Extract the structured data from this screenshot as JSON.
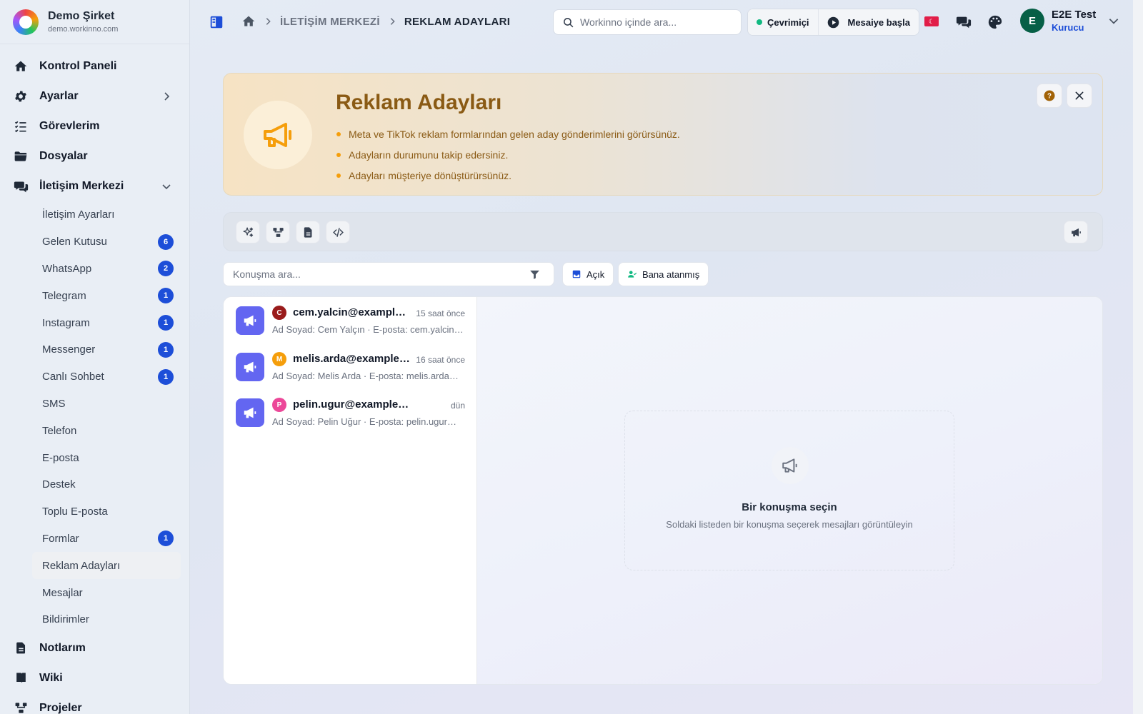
{
  "brand": {
    "name": "Demo Şirket",
    "domain": "demo.workinno.com"
  },
  "nav": {
    "dashboard": "Kontrol Paneli",
    "settings": "Ayarlar",
    "tasks": "Görevlerim",
    "files": "Dosyalar",
    "comm_center": "İletişim Merkezi",
    "sub_items": [
      {
        "label": "İletişim Ayarları",
        "badge": ""
      },
      {
        "label": "Gelen Kutusu",
        "badge": "6"
      },
      {
        "label": "WhatsApp",
        "badge": "2"
      },
      {
        "label": "Telegram",
        "badge": "1"
      },
      {
        "label": "Instagram",
        "badge": "1"
      },
      {
        "label": "Messenger",
        "badge": "1"
      },
      {
        "label": "Canlı Sohbet",
        "badge": "1"
      },
      {
        "label": "SMS",
        "badge": ""
      },
      {
        "label": "Telefon",
        "badge": ""
      },
      {
        "label": "E-posta",
        "badge": ""
      },
      {
        "label": "Destek",
        "badge": ""
      },
      {
        "label": "Toplu E-posta",
        "badge": ""
      },
      {
        "label": "Formlar",
        "badge": "1"
      },
      {
        "label": "Reklam Adayları",
        "badge": ""
      },
      {
        "label": "Mesajlar",
        "badge": ""
      },
      {
        "label": "Bildirimler",
        "badge": ""
      }
    ],
    "notes": "Notlarım",
    "wiki": "Wiki",
    "projects": "Projeler"
  },
  "topbar": {
    "breadcrumb_1": "İLETİŞİM MERKEZİ",
    "breadcrumb_2": "REKLAM ADAYLARI",
    "search_placeholder": "Workinno içinde ara...",
    "status": "Çevrimiçi",
    "shift_button": "Mesaiye başla",
    "user_initial": "E",
    "user_name": "E2E Test",
    "user_role": "Kurucu"
  },
  "hero": {
    "title": "Reklam Adayları",
    "bullets": [
      "Meta ve TikTok reklam formlarından gelen aday gönderimlerini görürsünüz.",
      "Adayların durumunu takip edersiniz.",
      "Adayları müşteriye dönüştürürsünüz."
    ]
  },
  "filters": {
    "search_placeholder": "Konuşma ara...",
    "open_chip": "Açık",
    "assigned_chip": "Bana atanmış"
  },
  "conversations": [
    {
      "initial": "C",
      "color": "#991b1b",
      "email": "cem.yalcin@example.com",
      "time": "15 saat önce",
      "preview": "Ad Soyad: Cem Yalçın · E-posta: cem.yalcin@example.com"
    },
    {
      "initial": "M",
      "color": "#f59e0b",
      "email": "melis.arda@example.com",
      "time": "16 saat önce",
      "preview": "Ad Soyad: Melis Arda · E-posta: melis.arda@example.com"
    },
    {
      "initial": "P",
      "color": "#ec4899",
      "email": "pelin.ugur@example.com",
      "time": "dün",
      "preview": "Ad Soyad: Pelin Uğur · E-posta: pelin.ugur@example.com"
    }
  ],
  "empty_state": {
    "title": "Bir konuşma seçin",
    "subtitle": "Soldaki listeden bir konuşma seçerek mesajları görüntüleyin"
  },
  "colors": {
    "accent": "#1d4ed8",
    "lead_icon_bg": "#6366f1",
    "hero_text": "#8a5a14",
    "hero_bullet": "#f59e0b",
    "online": "#10b981"
  }
}
